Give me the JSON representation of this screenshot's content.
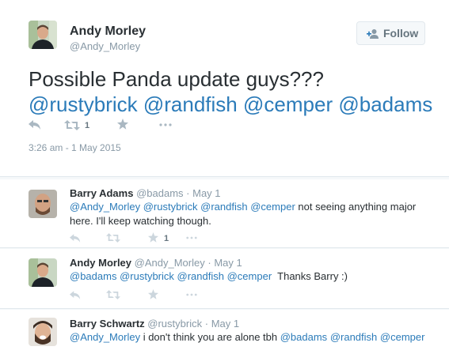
{
  "main_tweet": {
    "author_name": "Andy Morley",
    "author_handle": "@Andy_Morley",
    "follow_label": "Follow",
    "text_line1": "Possible Panda update guys???",
    "mentions": [
      "@rustybrick",
      "@randfish",
      "@cemper",
      "@badams"
    ],
    "retweet_count": "1",
    "timestamp": "3:26 am - 1 May 2015"
  },
  "replies": [
    {
      "name": "Barry Adams",
      "handle": "@badams",
      "sep": "·",
      "time": "May 1",
      "mentions": [
        "@Andy_Morley",
        "@rustybrick",
        "@randfish",
        "@cemper"
      ],
      "text_after": " not seeing anything major",
      "text_line2": "here. I'll keep watching though.",
      "favorite_count": "1"
    },
    {
      "name": "Andy Morley",
      "handle": "@Andy_Morley",
      "sep": "·",
      "time": "May 1",
      "mentions": [
        "@badams",
        "@rustybrick",
        "@randfish",
        "@cemper"
      ],
      "text_after": "  Thanks Barry :)"
    },
    {
      "name": "Barry Schwartz",
      "handle": "@rustybrick",
      "sep": "·",
      "time": "May 1",
      "mention_first": "@Andy_Morley",
      "text_middle": " i don't think you are alone tbh ",
      "mentions_end": [
        "@badams",
        "@randfish",
        "@cemper"
      ]
    }
  ],
  "icons": {
    "reply": "reply-icon",
    "retweet": "retweet-icon",
    "favorite": "favorite-star-icon",
    "more": "more-dots-icon",
    "follow": "follow-person-icon"
  },
  "colors": {
    "link": "#2b7bb9",
    "text": "#292f33",
    "muted": "#8899a6",
    "icon": "#aab8c2"
  }
}
